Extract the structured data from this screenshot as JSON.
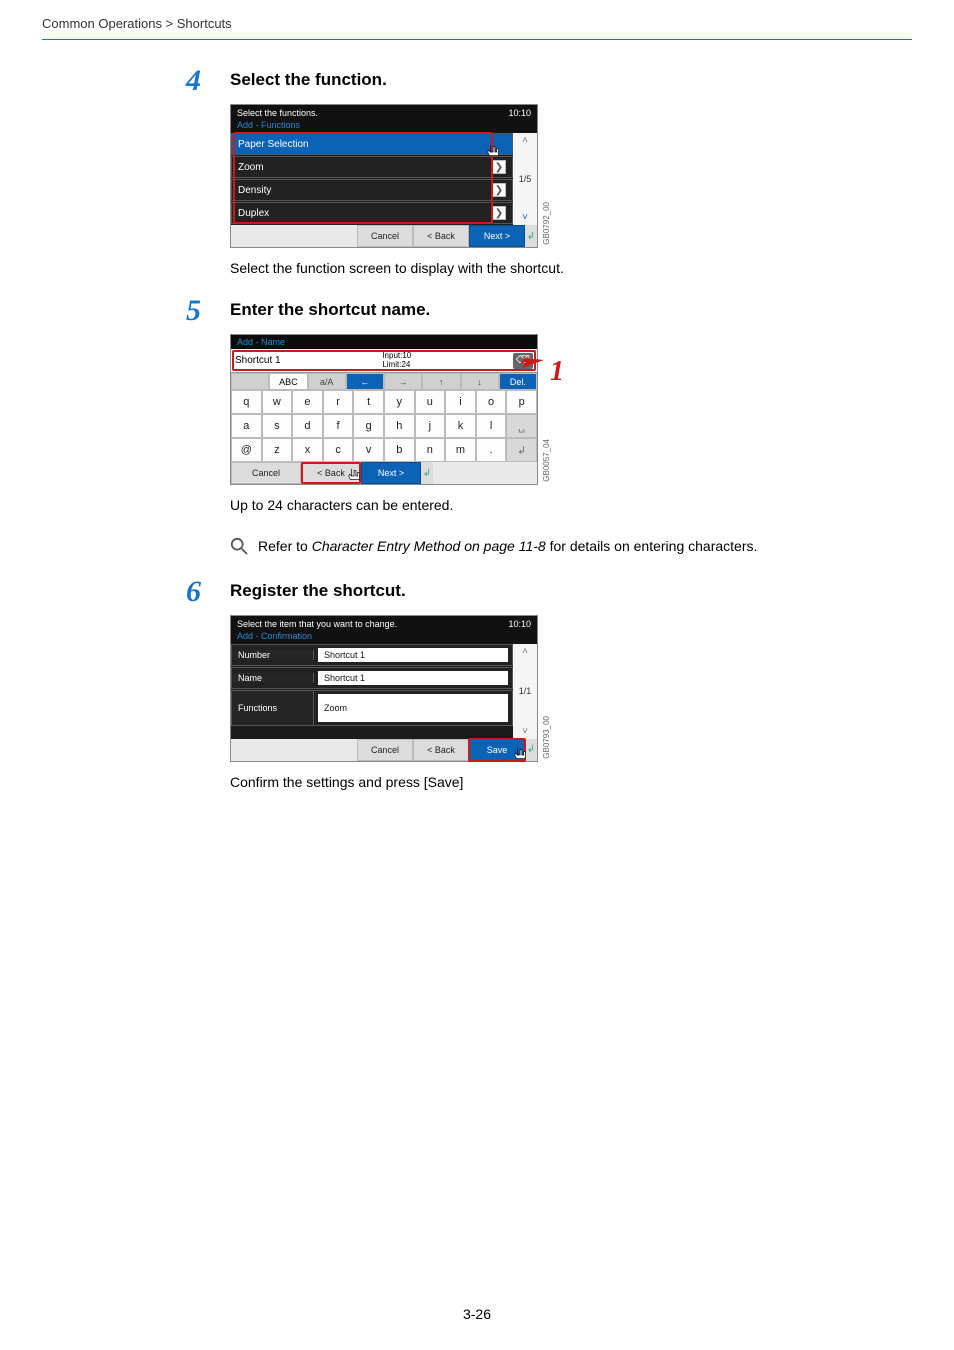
{
  "breadcrumb": "Common Operations > Shortcuts",
  "page_number": "3-26",
  "steps": {
    "s4": {
      "num": "4",
      "heading": "Select the function.",
      "caption": "Select the function screen to display with the shortcut.",
      "panel": {
        "prompt": "Select the functions.",
        "clock": "10:10",
        "subtitle": "Add - Functions",
        "rows": [
          "Paper Selection",
          "Zoom",
          "Density",
          "Duplex"
        ],
        "page_ind": "1/5",
        "buttons": {
          "cancel": "Cancel",
          "back": "< Back",
          "next": "Next >"
        },
        "sidecode": "GB0792_00"
      }
    },
    "s5": {
      "num": "5",
      "heading": "Enter the shortcut name.",
      "caption": "Up to 24 characters can be entered.",
      "note": {
        "pre": "Refer to ",
        "ital": "Character Entry Method on page 11-8",
        "post": " for details on entering characters."
      },
      "callout": "1",
      "panel": {
        "subtitle": "Add - Name",
        "field_label": "Shortcut 1",
        "input_count": "Input:10",
        "limit_count": "Limit:24",
        "mode_row": [
          "",
          "ABC",
          "a/A",
          "←",
          "→",
          "↑",
          "↓",
          "Del."
        ],
        "keys_r1": [
          "q",
          "w",
          "e",
          "r",
          "t",
          "y",
          "u",
          "i",
          "o",
          "p"
        ],
        "keys_r2": [
          "a",
          "s",
          "d",
          "f",
          "g",
          "h",
          "j",
          "k",
          "l",
          ""
        ],
        "keys_r3": [
          "@",
          "z",
          "x",
          "c",
          "v",
          "b",
          "n",
          "m",
          ".",
          ""
        ],
        "buttons": {
          "cancel": "Cancel",
          "back": "< Back",
          "next": "Next >"
        },
        "sidecode": "GB0057_04"
      }
    },
    "s6": {
      "num": "6",
      "heading": "Register the shortcut.",
      "caption": "Confirm the settings and press [Save]",
      "panel": {
        "prompt": "Select the item that you want to change.",
        "clock": "10:10",
        "subtitle": "Add - Confirmation",
        "rows": [
          {
            "label": "Number",
            "value": "Shortcut 1"
          },
          {
            "label": "Name",
            "value": "Shortcut 1"
          },
          {
            "label": "Functions",
            "value": "Zoom"
          }
        ],
        "page_ind": "1/1",
        "buttons": {
          "cancel": "Cancel",
          "back": "< Back",
          "save": "Save"
        },
        "sidecode": "GB0793_00"
      }
    }
  }
}
